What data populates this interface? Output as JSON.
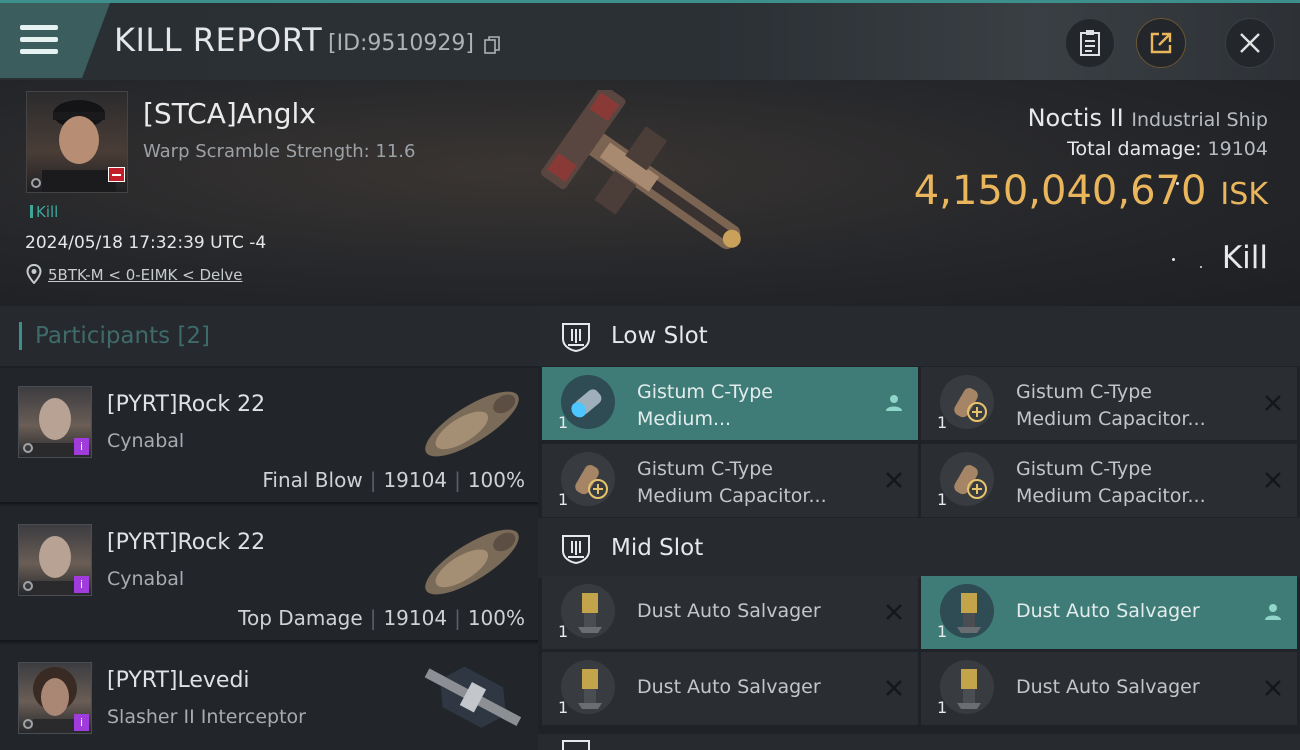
{
  "header": {
    "title": "KILL REPORT",
    "kill_id": "[ID:9510929]"
  },
  "victim": {
    "pilot_name": "[STCA]Anglx",
    "warp_scramble": "Warp Scramble Strength: 11.6",
    "kill_tag": "Kill",
    "timestamp": "2024/05/18 17:32:39 UTC -4",
    "location": "5BTK-M < 0-EIMK < Delve",
    "ship_name": "Noctis II",
    "ship_class": "Industrial Ship",
    "total_damage_label": "Total damage:",
    "total_damage": "19104",
    "isk_value": "4,150,040,670",
    "isk_unit": "ISK",
    "result": "Kill"
  },
  "participants": {
    "label": "Participants",
    "count": "[2]",
    "items": [
      {
        "name": "[PYRT]Rock 22",
        "ship": "Cynabal",
        "role": "Final Blow",
        "damage": "19104",
        "percent": "100%"
      },
      {
        "name": "[PYRT]Rock 22",
        "ship": "Cynabal",
        "role": "Top Damage",
        "damage": "19104",
        "percent": "100%"
      },
      {
        "name": "[PYRT]Levedi",
        "ship": "Slasher II Interceptor"
      }
    ]
  },
  "fittings": {
    "low_slot": {
      "label": "Low Slot",
      "items": [
        {
          "line1": "Gistum C-Type",
          "line2": "Medium...",
          "qty": "1",
          "highlight": true
        },
        {
          "line1": "Gistum C-Type",
          "line2": "Medium Capacitor...",
          "qty": "1"
        },
        {
          "line1": "Gistum C-Type",
          "line2": "Medium Capacitor...",
          "qty": "1"
        },
        {
          "line1": "Gistum C-Type",
          "line2": "Medium Capacitor...",
          "qty": "1"
        }
      ]
    },
    "mid_slot": {
      "label": "Mid Slot",
      "items": [
        {
          "name": "Dust Auto Salvager",
          "qty": "1"
        },
        {
          "name": "Dust Auto Salvager",
          "qty": "1",
          "highlight": true
        },
        {
          "name": "Dust Auto Salvager",
          "qty": "1"
        },
        {
          "name": "Dust Auto Salvager",
          "qty": "1"
        }
      ]
    }
  },
  "colors": {
    "accent": "#3c8f8a",
    "isk": "#e9b65c",
    "highlight_slot": "#3f7c77"
  }
}
